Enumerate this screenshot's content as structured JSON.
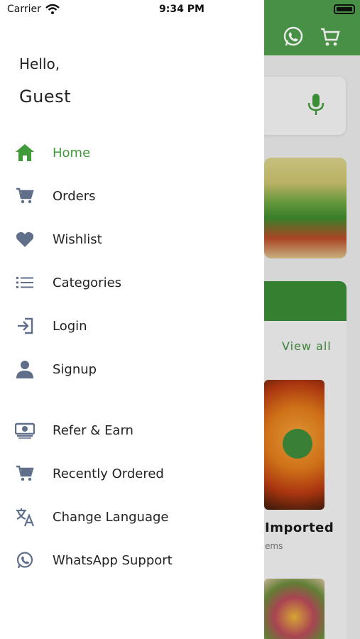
{
  "status_bar": {
    "carrier": "Carrier",
    "time": "9:34 PM"
  },
  "drawer": {
    "greeting": "Hello,",
    "user_name": "Guest",
    "items": [
      {
        "label": "Home",
        "icon": "home-icon",
        "active": true
      },
      {
        "label": "Orders",
        "icon": "cart-icon"
      },
      {
        "label": "Wishlist",
        "icon": "heart-icon"
      },
      {
        "label": "Categories",
        "icon": "list-icon"
      },
      {
        "label": "Login",
        "icon": "login-icon"
      },
      {
        "label": "Signup",
        "icon": "person-icon"
      },
      {
        "label": "Refer & Earn",
        "icon": "money-icon"
      },
      {
        "label": "Recently Ordered",
        "icon": "cart-icon"
      },
      {
        "label": "Change Language",
        "icon": "translate-icon"
      },
      {
        "label": "WhatsApp Support",
        "icon": "whatsapp-icon"
      }
    ]
  },
  "background": {
    "view_all": "View all",
    "product_title": "Imported",
    "product_subtitle": "ems"
  },
  "colors": {
    "accent": "#3f9a3a",
    "icon": "#5f6f8a",
    "header": "#4f9d4b"
  }
}
